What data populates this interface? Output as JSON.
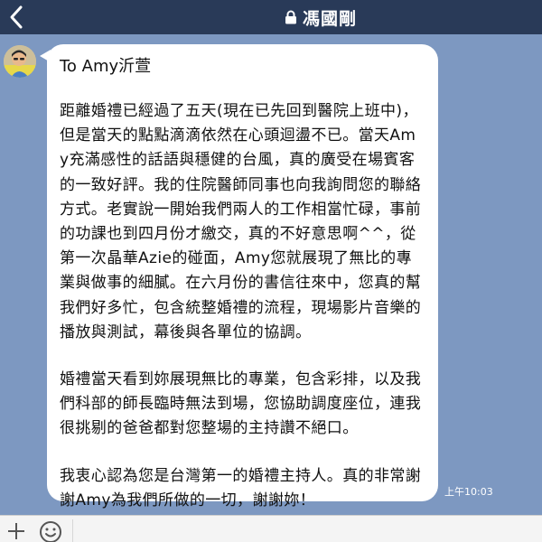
{
  "header": {
    "back_icon": "chevron-left-icon",
    "lock_icon": "lock-icon",
    "title": "馮國剛"
  },
  "message": {
    "avatar": "user-avatar",
    "greeting": "To Amy沂萱",
    "paragraphs": [
      "距離婚禮已經過了五天(現在已先回到醫院上班中)，但是當天的點點滴滴依然在心頭迴盪不已。當天Amy充滿感性的話語與穩健的台風，真的廣受在場賓客的一致好評。我的住院醫師同事也向我詢問您的聯絡方式。老實說一開始我們兩人的工作相當忙碌，事前的功課也到四月份才繳交，真的不好意思啊^^，從第一次晶華Azie的碰面，Amy您就展現了無比的專業與做事的細膩。在六月份的書信往來中，您真的幫我們好多忙，包含統整婚禮的流程，現場影片音樂的播放與測試，幕後與各單位的協調。",
      "婚禮當天看到妳展現無比的專業，包含彩排，以及我們科部的師長臨時無法到場，您協助調度座位，連我很挑剔的爸爸都對您整場的主持讚不絕口。",
      "我衷心認為您是台灣第一的婚禮主持人。真的非常謝謝Amy為我們所做的一切，謝謝妳！"
    ],
    "timestamp": "上午10:03"
  },
  "input_bar": {
    "add_icon": "plus-icon",
    "emoji_icon": "emoji-icon",
    "placeholder": ""
  },
  "colors": {
    "header_bg": "#293a58",
    "chat_bg": "#7d98c1",
    "bubble_bg": "#ffffff",
    "input_bar_bg": "#f4f4f4"
  }
}
